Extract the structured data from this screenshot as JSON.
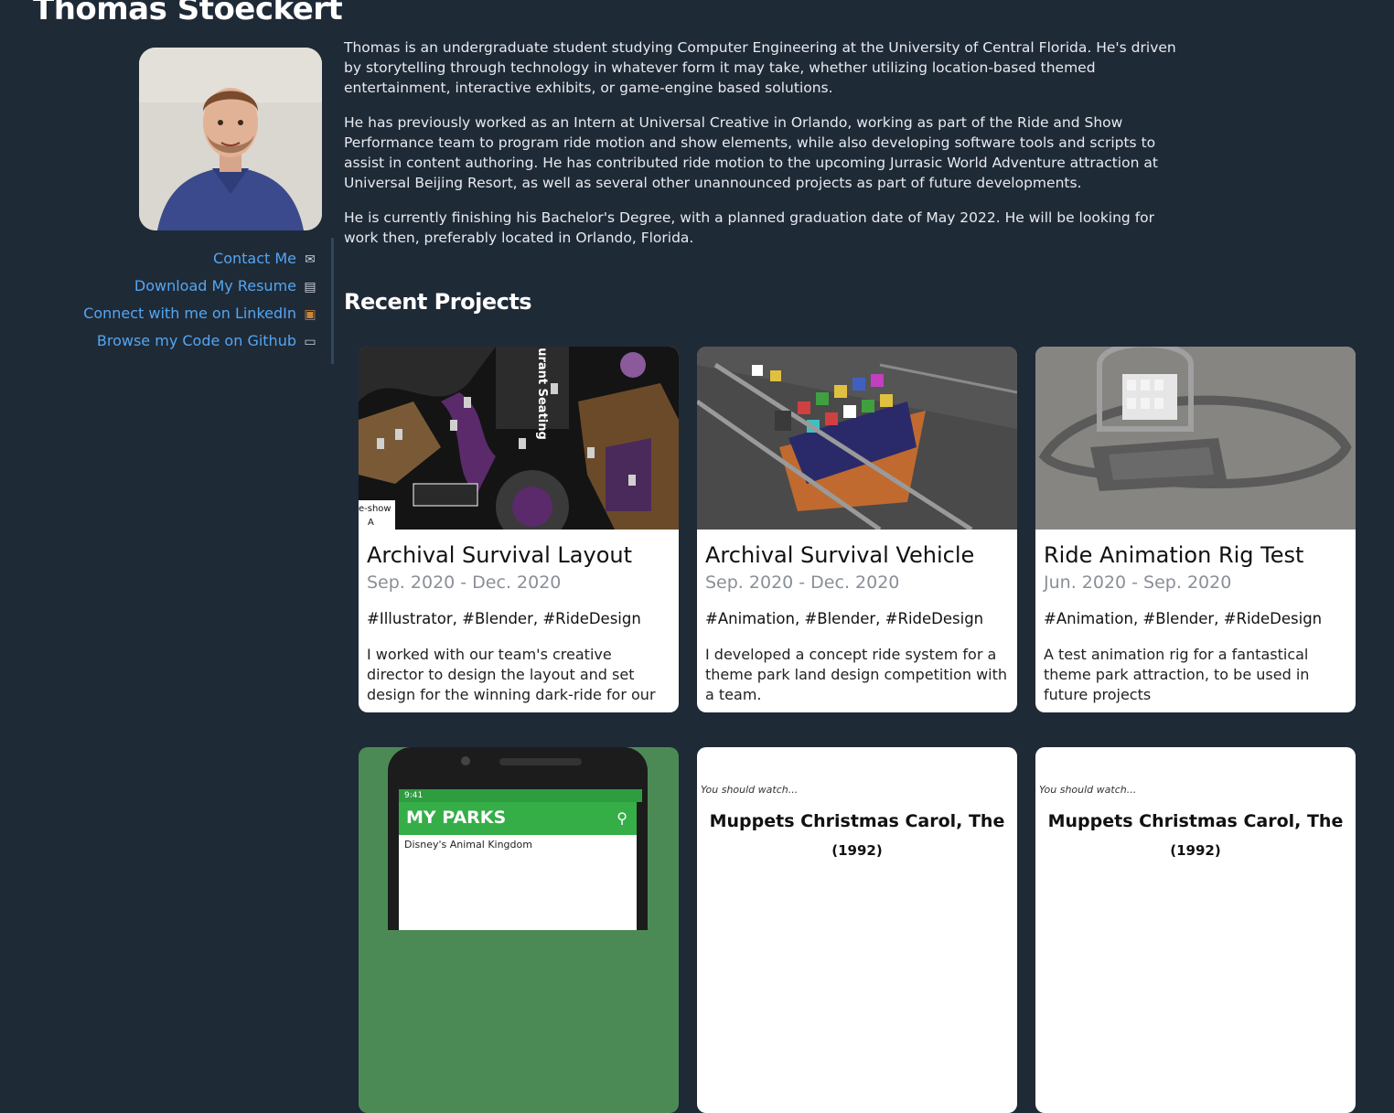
{
  "profile": {
    "name": "Thomas Stoeckert",
    "links": [
      {
        "label": "Contact Me",
        "icon": "envelope-icon",
        "glyph": "✉"
      },
      {
        "label": "Download My Resume",
        "icon": "document-icon",
        "glyph": "▤"
      },
      {
        "label": "Connect with me on LinkedIn",
        "icon": "briefcase-icon",
        "glyph": "▣"
      },
      {
        "label": "Browse my Code on Github",
        "icon": "monitor-icon",
        "glyph": "▭"
      }
    ]
  },
  "bio": {
    "p1": "Thomas is an undergraduate student studying Computer Engineering at the University of Central Florida. He's driven by storytelling through technology in whatever form it may take, whether utilizing location-based themed entertainment, interactive exhibits, or game-engine based solutions.",
    "p2": "He has previously worked as an Intern at Universal Creative in Orlando, working as part of the Ride and Show Performance team to program ride motion and show elements, while also developing software tools and scripts to assist in content authoring. He has contributed ride motion to the upcoming Jurrasic World Adventure attraction at Universal Beijing Resort, as well as several other unannounced projects as part of future developments.",
    "p3": "He is currently finishing his Bachelor's Degree, with a planned graduation date of May 2022. He will be looking for work then, preferably located in Orlando, Florida."
  },
  "projects": {
    "heading": "Recent Projects",
    "cards": [
      {
        "title": "Archival Survival Layout",
        "date": "Sep. 2020 - Dec. 2020",
        "tags": "#Illustrator, #Blender, #RideDesign",
        "description": "I worked with our team's creative director to design the layout and set design for the winning dark-ride for our theme park competition.",
        "thumb_text_1": "urant Seating",
        "thumb_text_2": "e-show",
        "thumb_text_3": "A"
      },
      {
        "title": "Archival Survival Vehicle",
        "date": "Sep. 2020 - Dec. 2020",
        "tags": "#Animation, #Blender, #RideDesign",
        "description": "I developed a concept ride system for a theme park land design competition with a team."
      },
      {
        "title": "Ride Animation Rig Test",
        "date": "Jun. 2020 - Sep. 2020",
        "tags": "#Animation, #Blender, #RideDesign",
        "description": "A test animation rig for a fantastical theme park attraction, to be used in future projects"
      }
    ],
    "preview_phone": {
      "time": "9:41",
      "app_title": "MY PARKS",
      "row_label": "Disney's Animal Kingdom"
    },
    "preview_movies": [
      {
        "kicker": "You should watch...",
        "title": "Muppets Christmas Carol, The",
        "year": "(1992)"
      },
      {
        "kicker": "You should watch...",
        "title": "Muppets Christmas Carol, The",
        "year": "(1992)"
      }
    ]
  },
  "colors": {
    "background": "#1f2a37",
    "link": "#53a6f2",
    "date_gray": "#8a8f97",
    "app_green": "#35ae48"
  }
}
